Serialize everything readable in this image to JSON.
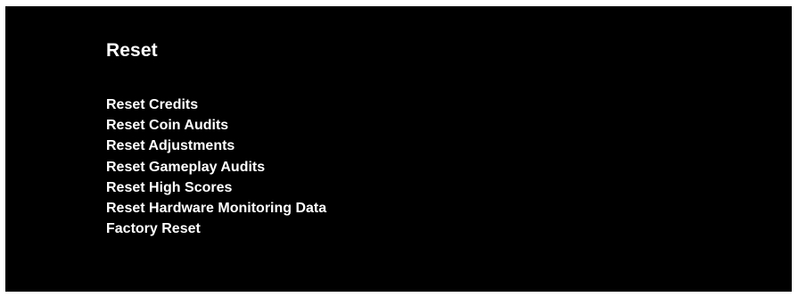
{
  "screen": {
    "title": "Reset",
    "menu_items": [
      {
        "label": "Reset Credits"
      },
      {
        "label": "Reset Coin Audits"
      },
      {
        "label": "Reset Adjustments"
      },
      {
        "label": "Reset Gameplay Audits"
      },
      {
        "label": "Reset High Scores"
      },
      {
        "label": "Reset Hardware Monitoring Data"
      },
      {
        "label": "Factory Reset"
      }
    ]
  },
  "colors": {
    "background": "#000000",
    "text": "#ffffff",
    "page_border": "#ffffff"
  }
}
